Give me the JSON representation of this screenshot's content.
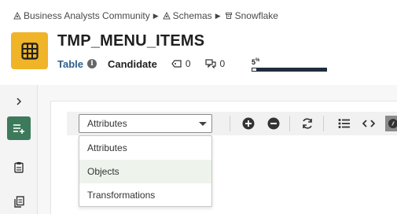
{
  "breadcrumb": [
    {
      "label": "Business Analysts Community",
      "icon": "community-icon"
    },
    {
      "label": "Schemas",
      "icon": "schema-icon"
    },
    {
      "label": "Snowflake",
      "icon": "database-icon"
    }
  ],
  "asset": {
    "title": "TMP_MENU_ITEMS",
    "type": "Table",
    "status": "Candidate",
    "tags_count": "0",
    "comments_count": "0",
    "completeness_percent": 5,
    "completeness_label": "5",
    "completeness_unit": "%"
  },
  "colors": {
    "asset_icon_bg": "#f0b429",
    "active_rail": "#3d7a5c",
    "type_link": "#2c5f8a",
    "progress_track": "#1f2d3d"
  },
  "sidebar": {
    "items": [
      {
        "name": "expand",
        "icon": "chevron-right-icon"
      },
      {
        "name": "add-attribute",
        "icon": "add-list-icon",
        "active": true
      },
      {
        "name": "clipboard",
        "icon": "clipboard-icon"
      },
      {
        "name": "copy-document",
        "icon": "copy-document-icon"
      }
    ]
  },
  "toolbar": {
    "select_value": "Attributes",
    "buttons": [
      "add-circle-icon",
      "remove-circle-icon",
      "refresh-icon",
      "list-icon",
      "code-icon",
      "compass-icon"
    ]
  },
  "dropdown": {
    "options": [
      "Attributes",
      "Objects",
      "Transformations"
    ],
    "hovered": "Objects"
  }
}
